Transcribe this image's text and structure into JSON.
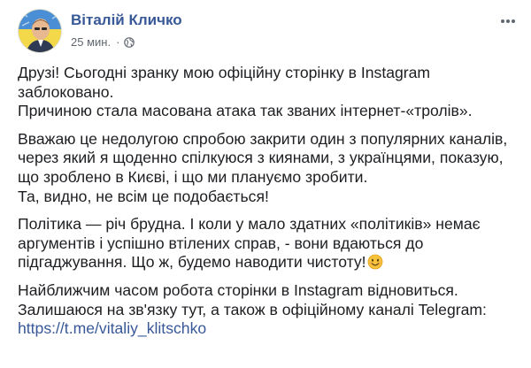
{
  "author": {
    "name": "Віталій Кличко",
    "avatar_icon": "profile-photo-avatar"
  },
  "meta": {
    "time": "25 мин.",
    "separator": "·",
    "audience_icon": "globe-icon"
  },
  "colors": {
    "author_link": "#385898",
    "meta_text": "#616770",
    "body_text": "#1c1e21",
    "link": "#385898"
  },
  "post": {
    "paragraphs": [
      {
        "lines": [
          "Друзі! Сьогодні зранку мою офіційну сторінку в Instagram",
          "заблоковано.",
          "Причиною стала масована атака так званих інтернет-«тролів»."
        ]
      },
      {
        "lines": [
          "Вважаю це недолугою спробою закрити один з популярних каналів,",
          "через який я щоденно спілкуюся з киянами, з українцями, показую,",
          "що зроблено в Києві, і що ми плануємо зробити.",
          "Та, видно, не всім це подобається!"
        ]
      },
      {
        "lines": [
          "Політика — річ брудна. І коли у мало здатних «політиків» немає",
          "аргументів і успішно втілених справ, - вони вдаються до",
          "підгаджування. Що ж, будемо наводити чистоту!"
        ],
        "emoji": "smiling-face-emoji"
      },
      {
        "lines": [
          "Найближчим часом робота сторінки в Instagram відновиться.",
          "Залишаюся на зв'язку тут, а також в офіційному каналі Telegram:"
        ],
        "link": "https://t.me/vitaliy_klitschko"
      }
    ]
  }
}
